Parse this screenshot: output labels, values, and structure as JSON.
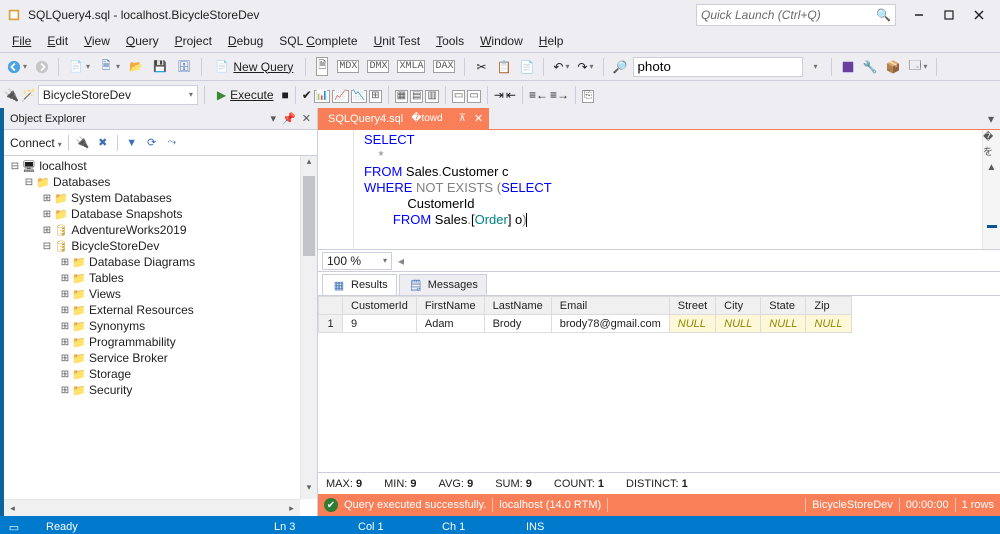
{
  "titlebar": {
    "title": "SQLQuery4.sql - localhost.BicycleStoreDev"
  },
  "quick_launch": {
    "placeholder": "Quick Launch (Ctrl+Q)"
  },
  "menu": {
    "file": "File",
    "edit": "Edit",
    "view": "View",
    "query": "Query",
    "project": "Project",
    "debug": "Debug",
    "sqlcomplete": "SQL Complete",
    "unittest": "Unit Test",
    "tools": "Tools",
    "window": "Window",
    "help": "Help"
  },
  "toolbar1": {
    "new_query": "New Query",
    "find_text": "photo"
  },
  "toolbar2": {
    "database": "BicycleStoreDev",
    "execute": "Execute"
  },
  "obj_explorer": {
    "title": "Object Explorer",
    "connect": "Connect",
    "tree": {
      "server": "localhost",
      "databases": "Databases",
      "system_databases": "System Databases",
      "snapshots": "Database Snapshots",
      "aw": "AdventureWorks2019",
      "bsd": "BicycleStoreDev",
      "diagrams": "Database Diagrams",
      "tables": "Tables",
      "views": "Views",
      "ext": "External Resources",
      "syn": "Synonyms",
      "prog": "Programmability",
      "sb": "Service Broker",
      "storage": "Storage",
      "security": "Security"
    }
  },
  "doc_tab": {
    "name": "SQLQuery4.sql"
  },
  "editor": {
    "zoom": "100 %",
    "sql_lines": [
      {
        "parts": [
          {
            "t": "SELECT",
            "c": "kw"
          }
        ]
      },
      {
        "parts": [
          {
            "t": "    *",
            "c": "op"
          }
        ]
      },
      {
        "parts": [
          {
            "t": "FROM",
            "c": "kw"
          },
          {
            "t": " Sales",
            "c": "ident"
          },
          {
            "t": ".",
            "c": "op"
          },
          {
            "t": "Customer",
            "c": "ident"
          },
          {
            "t": " c",
            "c": "ident"
          }
        ]
      },
      {
        "parts": [
          {
            "t": "WHERE",
            "c": "kw"
          },
          {
            "t": " ",
            "c": "ident"
          },
          {
            "t": "NOT",
            "c": "op"
          },
          {
            "t": " ",
            "c": "ident"
          },
          {
            "t": "EXISTS",
            "c": "op"
          },
          {
            "t": " ",
            "c": "ident"
          },
          {
            "t": "(",
            "c": "op"
          },
          {
            "t": "SELECT",
            "c": "kw"
          }
        ]
      },
      {
        "parts": [
          {
            "t": "            CustomerId",
            "c": "ident"
          }
        ]
      },
      {
        "parts": [
          {
            "t": "        ",
            "c": "ident"
          },
          {
            "t": "FROM",
            "c": "kw"
          },
          {
            "t": " Sales",
            "c": "ident"
          },
          {
            "t": ".",
            "c": "op"
          },
          {
            "t": "[",
            "c": "ident"
          },
          {
            "t": "Order",
            "c": "obj"
          },
          {
            "t": "]",
            "c": "ident"
          },
          {
            "t": " o",
            "c": "ident"
          },
          {
            "t": ")",
            "c": "op"
          }
        ],
        "caret": true
      }
    ]
  },
  "results": {
    "tab_results": "Results",
    "tab_messages": "Messages",
    "columns": [
      "CustomerId",
      "FirstName",
      "LastName",
      "Email",
      "Street",
      "City",
      "State",
      "Zip"
    ],
    "rows": [
      {
        "n": "1",
        "cells": [
          "9",
          "Adam",
          "Brody",
          "brody78@gmail.com",
          "NULL",
          "NULL",
          "NULL",
          "NULL"
        ]
      }
    ]
  },
  "stats": {
    "max_l": "MAX:",
    "max_v": "9",
    "min_l": "MIN:",
    "min_v": "9",
    "avg_l": "AVG:",
    "avg_v": "9",
    "sum_l": "SUM:",
    "sum_v": "9",
    "count_l": "COUNT:",
    "count_v": "1",
    "distinct_l": "DISTINCT:",
    "distinct_v": "1"
  },
  "query_status": {
    "msg": "Query executed successfully.",
    "server": "localhost (14.0 RTM)",
    "db": "BicycleStoreDev",
    "time": "00:00:00",
    "rows": "1 rows"
  },
  "statusbar": {
    "ready": "Ready",
    "ln": "Ln 3",
    "col": "Col 1",
    "ch": "Ch 1",
    "ins": "INS"
  }
}
